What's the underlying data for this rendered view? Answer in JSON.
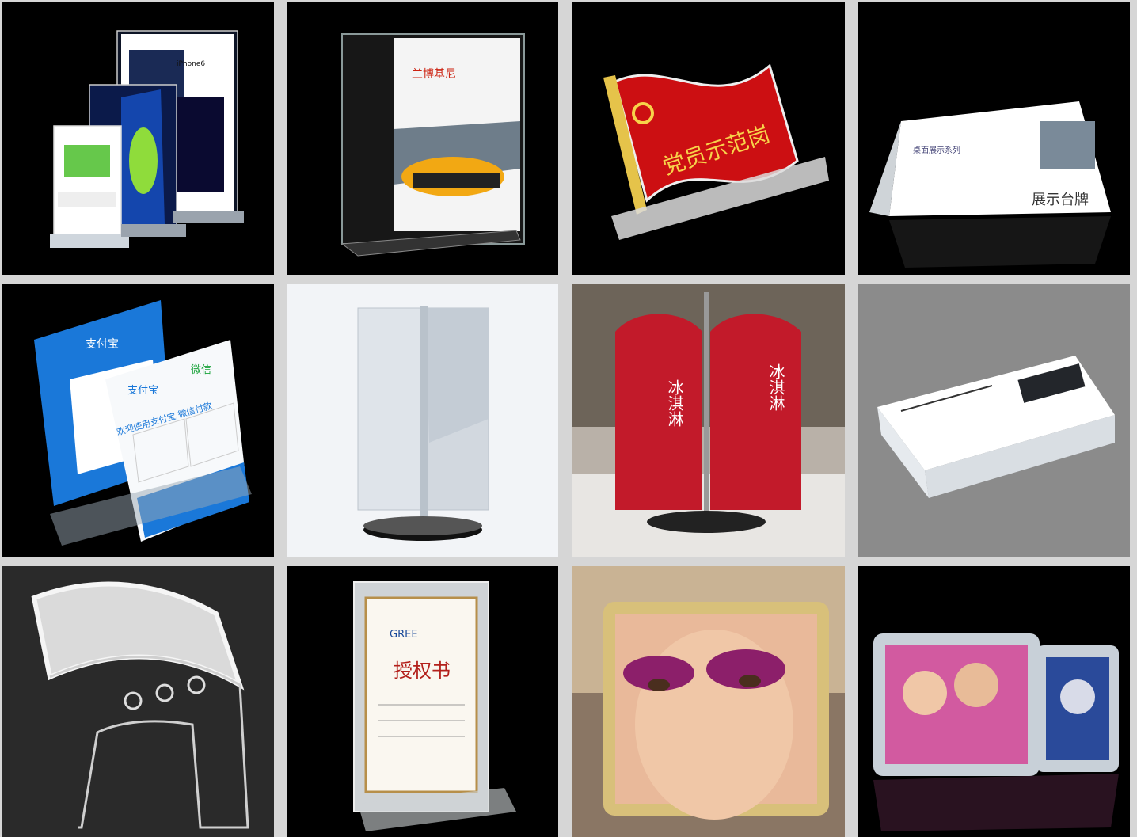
{
  "tiles": [
    {
      "id": "tile-1",
      "subject": "acrylic-poster-stands",
      "labels": {
        "brand": "iPhone6",
        "sub": "iPhone 6"
      }
    },
    {
      "id": "tile-2",
      "subject": "t-shaped-menu-holder",
      "labels": {
        "brand": "兰博基尼"
      }
    },
    {
      "id": "tile-3",
      "subject": "flag-shaped-desk-sign",
      "labels": {
        "text": "党员示范岗"
      }
    },
    {
      "id": "tile-4",
      "subject": "tent-name-card-holder",
      "labels": {
        "series": "桌面展示系列",
        "name": "展示台牌"
      }
    },
    {
      "id": "tile-5",
      "subject": "payment-qr-sign-holders",
      "labels": {
        "alipay": "支付宝",
        "wechat": "微信",
        "welcome": "欢迎使用支付宝/微信付款"
      }
    },
    {
      "id": "tile-6",
      "subject": "rotating-double-sided-stand",
      "labels": {}
    },
    {
      "id": "tile-7",
      "subject": "rotating-menu-display",
      "labels": {
        "left": "冰淇淋",
        "right": "冰淇淋"
      }
    },
    {
      "id": "tile-8",
      "subject": "slanted-block-label-holder",
      "labels": {}
    },
    {
      "id": "tile-9",
      "subject": "curved-ring-binder-stand",
      "labels": {}
    },
    {
      "id": "tile-10",
      "subject": "certificate-frame",
      "labels": {
        "brand": "GREE",
        "title": "授权书"
      }
    },
    {
      "id": "tile-11",
      "subject": "magnetic-photo-block",
      "labels": {}
    },
    {
      "id": "tile-12",
      "subject": "couple-photo-blocks",
      "labels": {}
    }
  ]
}
